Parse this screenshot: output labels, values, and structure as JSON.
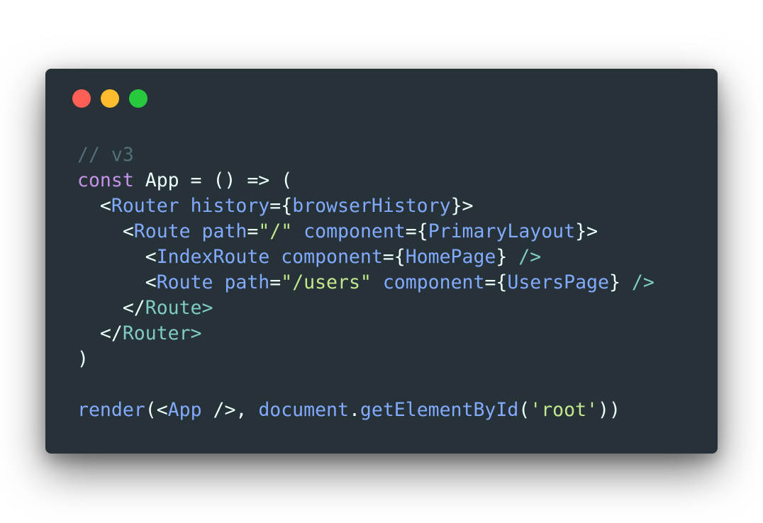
{
  "window": {
    "controls": {
      "close_color": "#ff5f56",
      "minimize_color": "#ffbd2e",
      "maximize_color": "#27c93f"
    }
  },
  "code": {
    "lines": [
      [
        {
          "t": "// v3",
          "c": "comment"
        }
      ],
      [
        {
          "t": "const",
          "c": "keyword"
        },
        {
          "t": " App = () => (",
          "c": "plain"
        }
      ],
      [
        {
          "t": "  <",
          "c": "plain"
        },
        {
          "t": "Router",
          "c": "tag"
        },
        {
          "t": " ",
          "c": "plain"
        },
        {
          "t": "history",
          "c": "attr"
        },
        {
          "t": "={",
          "c": "plain"
        },
        {
          "t": "browserHistory",
          "c": "tag"
        },
        {
          "t": "}>",
          "c": "plain"
        }
      ],
      [
        {
          "t": "    <",
          "c": "plain"
        },
        {
          "t": "Route",
          "c": "tag"
        },
        {
          "t": " ",
          "c": "plain"
        },
        {
          "t": "path",
          "c": "attr"
        },
        {
          "t": "=",
          "c": "plain"
        },
        {
          "t": "\"/\"",
          "c": "str"
        },
        {
          "t": " ",
          "c": "plain"
        },
        {
          "t": "component",
          "c": "attr"
        },
        {
          "t": "={",
          "c": "plain"
        },
        {
          "t": "PrimaryLayout",
          "c": "tag"
        },
        {
          "t": "}>",
          "c": "plain"
        }
      ],
      [
        {
          "t": "      <",
          "c": "plain"
        },
        {
          "t": "IndexRoute",
          "c": "tag"
        },
        {
          "t": " ",
          "c": "plain"
        },
        {
          "t": "component",
          "c": "attr"
        },
        {
          "t": "={",
          "c": "plain"
        },
        {
          "t": "HomePage",
          "c": "tag"
        },
        {
          "t": "} ",
          "c": "plain"
        },
        {
          "t": "/>",
          "c": "tagclose"
        }
      ],
      [
        {
          "t": "      <",
          "c": "plain"
        },
        {
          "t": "Route",
          "c": "tag"
        },
        {
          "t": " ",
          "c": "plain"
        },
        {
          "t": "path",
          "c": "attr"
        },
        {
          "t": "=",
          "c": "plain"
        },
        {
          "t": "\"/users\"",
          "c": "str"
        },
        {
          "t": " ",
          "c": "plain"
        },
        {
          "t": "component",
          "c": "attr"
        },
        {
          "t": "={",
          "c": "plain"
        },
        {
          "t": "UsersPage",
          "c": "tag"
        },
        {
          "t": "} ",
          "c": "plain"
        },
        {
          "t": "/>",
          "c": "tagclose"
        }
      ],
      [
        {
          "t": "    </",
          "c": "plain"
        },
        {
          "t": "Route>",
          "c": "tagclose"
        }
      ],
      [
        {
          "t": "  </",
          "c": "plain"
        },
        {
          "t": "Router>",
          "c": "tagclose"
        }
      ],
      [
        {
          "t": ")",
          "c": "plain"
        }
      ],
      [],
      [
        {
          "t": "render",
          "c": "func"
        },
        {
          "t": "(<",
          "c": "plain"
        },
        {
          "t": "App",
          "c": "tag"
        },
        {
          "t": " />, ",
          "c": "plain"
        },
        {
          "t": "document",
          "c": "tag"
        },
        {
          "t": ".",
          "c": "plain"
        },
        {
          "t": "getElementById",
          "c": "func"
        },
        {
          "t": "(",
          "c": "plain"
        },
        {
          "t": "'root'",
          "c": "str"
        },
        {
          "t": "))",
          "c": "plain"
        }
      ]
    ]
  }
}
